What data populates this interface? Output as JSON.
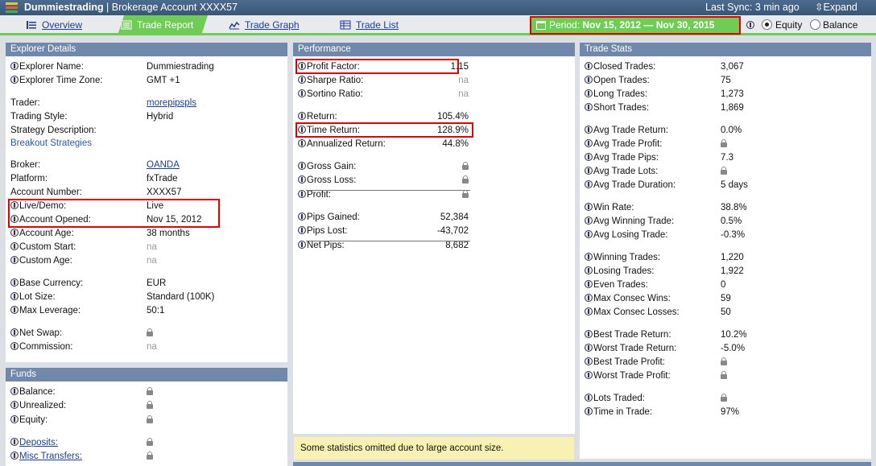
{
  "app": {
    "name": "Dummiestrading",
    "account_label": "Brokerage Account XXXX57",
    "sync": "Last Sync: 3 min ago",
    "expand": "Expand"
  },
  "colors": {
    "header": "#4d6b8f",
    "accent_green": "#6fcc55",
    "highlight_red": "#e00000",
    "panel_header": "#7089ab"
  },
  "tabs": [
    {
      "label": "Overview",
      "icon": "list-icon"
    },
    {
      "label": "Trade Report",
      "icon": "report-icon",
      "active": true
    },
    {
      "label": "Trade Graph",
      "icon": "line-chart-icon"
    },
    {
      "label": "Trade List",
      "icon": "table-icon"
    }
  ],
  "period": {
    "prefix": "Period:",
    "range": "Nov 15, 2012 — Nov 30, 2015"
  },
  "view_mode": {
    "options": [
      "Equity",
      "Balance"
    ],
    "selected": "Equity"
  },
  "explorer": {
    "title": "Explorer Details",
    "rows": [
      {
        "label": "Explorer Name:",
        "value": "Dummiestrading"
      },
      {
        "label": "Explorer Time Zone:",
        "value": "GMT +1"
      },
      {
        "label": "Trader:",
        "value": "morepipspls"
      },
      {
        "label": "Trading Style:",
        "value": "Hybrid"
      },
      {
        "label": "Strategy Description:",
        "value": ""
      },
      {
        "label": "Breakout Strategies",
        "value": ""
      },
      {
        "label": "Broker:",
        "value": "OANDA"
      },
      {
        "label": "Platform:",
        "value": "fxTrade"
      },
      {
        "label": "Account Number:",
        "value": "XXXX57"
      },
      {
        "label": "Live/Demo:",
        "value": "Live"
      },
      {
        "label": "Account Opened:",
        "value": "Nov 15, 2012"
      },
      {
        "label": "Account Age:",
        "value": "38 months"
      },
      {
        "label": "Custom Start:",
        "value": "na"
      },
      {
        "label": "Custom Age:",
        "value": "na"
      },
      {
        "label": "Base Currency:",
        "value": "EUR"
      },
      {
        "label": "Lot Size:",
        "value": "Standard (100K)"
      },
      {
        "label": "Max Leverage:",
        "value": "50:1"
      },
      {
        "label": "Net Swap:",
        "value": ""
      },
      {
        "label": "Commission:",
        "value": "na"
      }
    ]
  },
  "funds": {
    "title": "Funds",
    "rows": [
      {
        "label": "Balance:"
      },
      {
        "label": "Unrealized:"
      },
      {
        "label": "Equity:"
      },
      {
        "label": "Deposits:"
      },
      {
        "label": "Misc Transfers:"
      }
    ]
  },
  "performance": {
    "title": "Performance",
    "rows": [
      {
        "label": "Profit Factor:",
        "value": "1.15"
      },
      {
        "label": "Sharpe Ratio:",
        "value": "na"
      },
      {
        "label": "Sortino Ratio:",
        "value": "na"
      },
      {
        "label": "Return:",
        "value": "105.4%"
      },
      {
        "label": "Time Return:",
        "value": "128.9%"
      },
      {
        "label": "Annualized Return:",
        "value": "44.8%"
      },
      {
        "label": "Gross Gain:",
        "value": ""
      },
      {
        "label": "Gross Loss:",
        "value": ""
      },
      {
        "label": "Profit:",
        "value": ""
      },
      {
        "label": "Pips Gained:",
        "value": "52,384"
      },
      {
        "label": "Pips Lost:",
        "value": "-43,702"
      },
      {
        "label": "Net Pips:",
        "value": "8,682"
      }
    ],
    "note": "Some statistics omitted due to large account size."
  },
  "trade_stats": {
    "title": "Trade Stats",
    "rows": [
      {
        "label": "Closed Trades:",
        "value": "3,067"
      },
      {
        "label": "Open Trades:",
        "value": "75"
      },
      {
        "label": "Long Trades:",
        "value": "1,273"
      },
      {
        "label": "Short Trades:",
        "value": "1,869"
      },
      {
        "label": "Avg Trade Return:",
        "value": "0.0%"
      },
      {
        "label": "Avg Trade Profit:",
        "value": ""
      },
      {
        "label": "Avg Trade Pips:",
        "value": "7.3"
      },
      {
        "label": "Avg Trade Lots:",
        "value": ""
      },
      {
        "label": "Avg Trade Duration:",
        "value": "5 days"
      },
      {
        "label": "Win Rate:",
        "value": "38.8%"
      },
      {
        "label": "Avg Winning Trade:",
        "value": "0.5%"
      },
      {
        "label": "Avg Losing Trade:",
        "value": "-0.3%"
      },
      {
        "label": "Winning Trades:",
        "value": "1,220"
      },
      {
        "label": "Losing Trades:",
        "value": "1,922"
      },
      {
        "label": "Even Trades:",
        "value": "0"
      },
      {
        "label": "Max Consec Wins:",
        "value": "59"
      },
      {
        "label": "Max Consec Losses:",
        "value": "50"
      },
      {
        "label": "Best Trade Return:",
        "value": "10.2%"
      },
      {
        "label": "Worst Trade Return:",
        "value": "-5.0%"
      },
      {
        "label": "Best Trade Profit:",
        "value": ""
      },
      {
        "label": "Worst Trade Profit:",
        "value": ""
      },
      {
        "label": "Lots Traded:",
        "value": ""
      },
      {
        "label": "Time in Trade:",
        "value": "97%"
      }
    ]
  }
}
